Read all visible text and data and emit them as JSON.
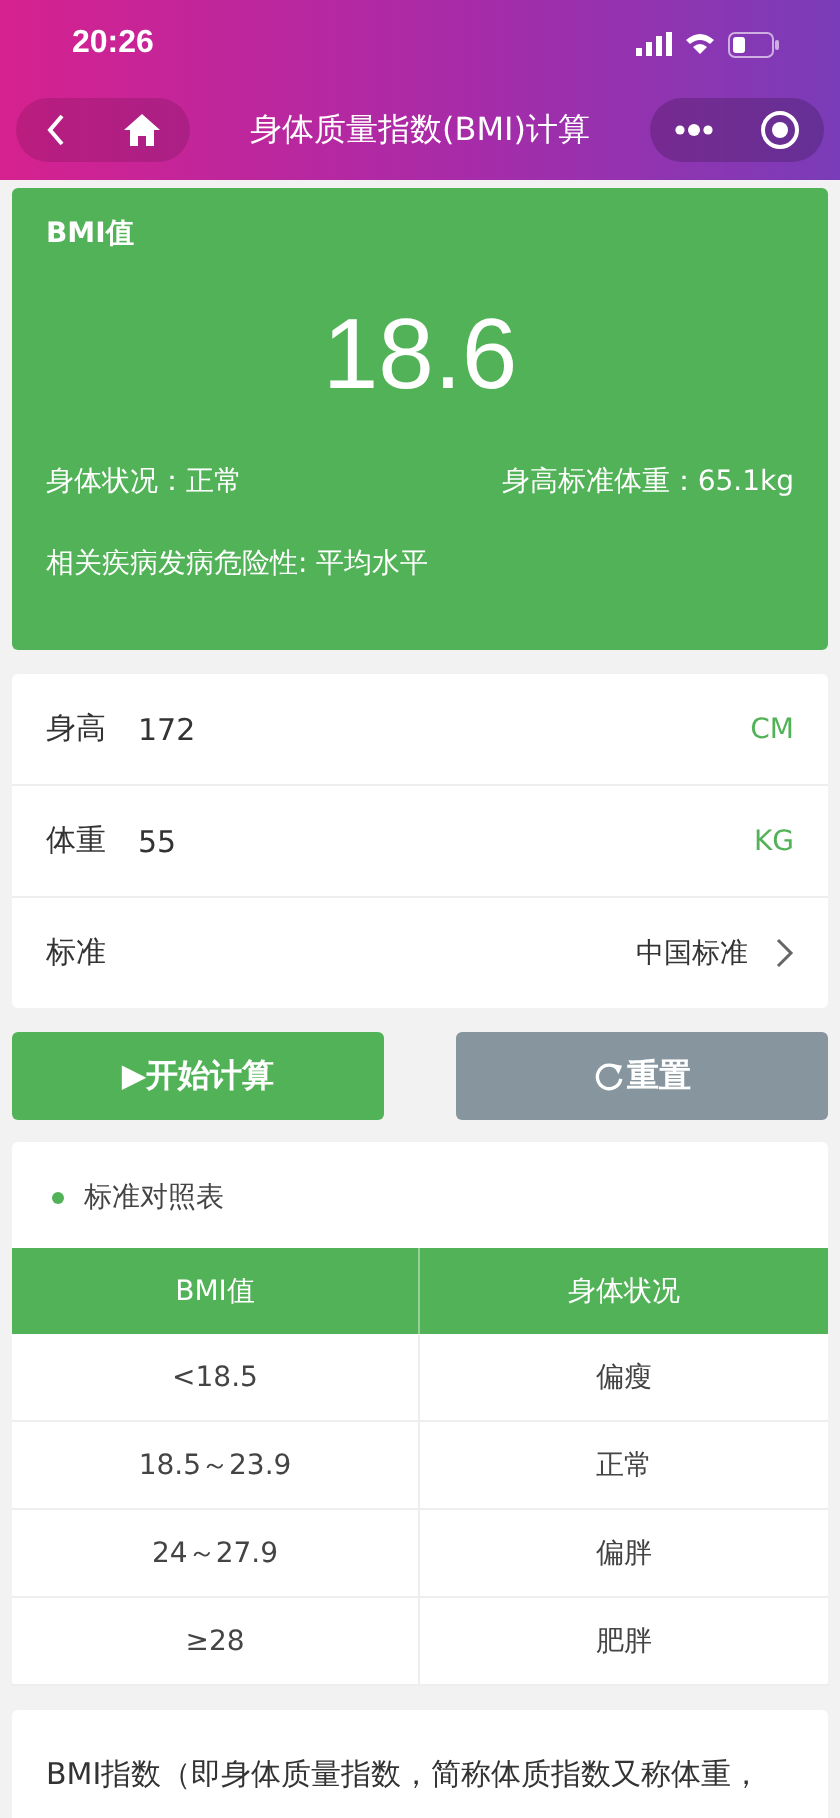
{
  "status_bar": {
    "time": "20:26"
  },
  "nav": {
    "title": "身体质量指数(BMI)计算"
  },
  "result": {
    "label": "BMI值",
    "value": "18.6",
    "condition": "身体状况：正常",
    "standard_weight": "身高标准体重：65.1kg",
    "risk": "相关疾病发病危险性: 平均水平"
  },
  "inputs": [
    {
      "kind": "field",
      "label": "身高",
      "value": "172",
      "unit": "CM"
    },
    {
      "kind": "field",
      "label": "体重",
      "value": "55",
      "unit": "KG"
    },
    {
      "kind": "select",
      "label": "标准",
      "value": "中国标准"
    }
  ],
  "buttons": [
    {
      "kind": "primary",
      "icon": "▶",
      "label": "开始计算"
    },
    {
      "kind": "reset",
      "label": "重置"
    }
  ],
  "table": {
    "title": "标准对照表",
    "columns": [
      "BMI值",
      "身体状况"
    ],
    "rows": [
      [
        "<18.5",
        "偏瘦"
      ],
      [
        "18.5～23.9",
        "正常"
      ],
      [
        "24～27.9",
        "偏胖"
      ],
      [
        "≥28",
        "肥胖"
      ]
    ]
  },
  "description": "BMI指数（即身体质量指数，简称体质指数又称体重，"
}
